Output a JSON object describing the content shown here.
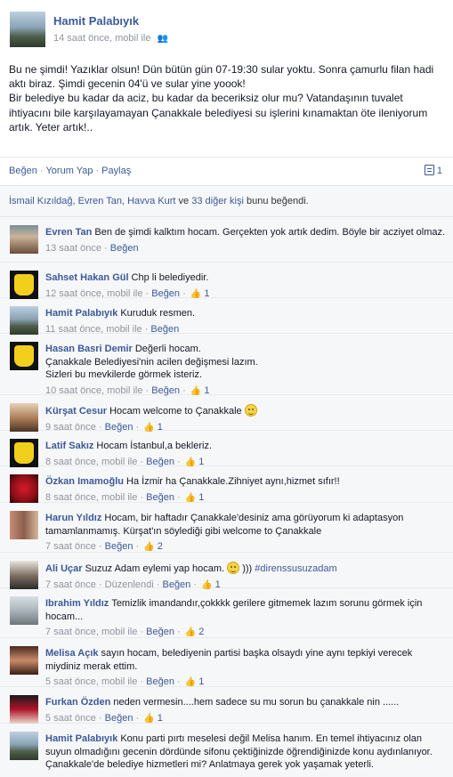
{
  "post": {
    "author": "Hamit Palabıyık",
    "meta": "14 saat önce, mobil ile",
    "body": [
      "Bu ne şimdi! Yazıklar olsun! Dün bütün gün 07-19:30 sular yoktu. Sonra çamurlu filan hadi aktı biraz. Şimdi gecenin 04'ü ve sular yine yoook!",
      "Bir belediye bu kadar da aciz, bu kadar da beceriksiz olur mu? Vatandaşının tuvalet ihtiyacını bile karşılayamayan Çanakkale belediyesi su işlerini kınamaktan öte ileniyorum artık. Yeter artık!.."
    ]
  },
  "actions": {
    "like": "Beğen",
    "comment": "Yorum Yap",
    "share": "Paylaş",
    "sep": "·",
    "comment_count": "1"
  },
  "likes_line": {
    "names": "İsmail Kızıldağ, Evren Tan, Havva Kurt",
    "conj": " ve ",
    "others": "33 diğer kişi",
    "suffix": " bunu beğendi."
  },
  "comments": [
    {
      "name": "Evren Tan",
      "text": "Ben de şimdi kalktım hocam. Gerçekten yok artık dedim. Böyle bir acziyet olmaz.",
      "time": "13 saat önce",
      "like": "Beğen",
      "likes": ""
    },
    {
      "name": "Sahset Hakan Gül",
      "text": "Chp li belediyedir.",
      "time": "12 saat önce, mobil ile",
      "like": "Beğen",
      "likes": "1"
    },
    {
      "name": "Hamit Palabıyık",
      "text": "Kuruduk resmen.",
      "time": "11 saat önce, mobil ile",
      "like": "Beğen",
      "likes": ""
    },
    {
      "name": "Hasan Basri Demir",
      "text": "Değerli hocam.",
      "text2": "Çanakkale Belediyesi'nin acilen değişmesi lazım.",
      "text3": "Sizleri bu mevkilerde görmek isteriz.",
      "time": "10 saat önce, mobil ile",
      "like": "Beğen",
      "likes": "1"
    },
    {
      "name": "Kürşat Cesur",
      "text": "Hocam welcome to Çanakkale",
      "time": "9 saat önce",
      "like": "Beğen",
      "likes": "1"
    },
    {
      "name": "Latif Sakız",
      "text": "Hocam İstanbul,a bekleriz.",
      "time": "8 saat önce, mobil ile",
      "like": "Beğen",
      "likes": "1"
    },
    {
      "name": "Özkan Imamoğlu",
      "text": "Ha İzmir ha Çanakkale.Zihniyet aynı,hizmet sıfır!!",
      "time": "8 saat önce, mobil ile",
      "like": "Beğen",
      "likes": "1"
    },
    {
      "name": "Harun Yıldız",
      "text": "Hocam, bir haftadır Çanakkale'desiniz ama görüyorum ki adaptasyon tamamlanmamış. Kürşat'ın söylediği gibi welcome to Çanakkale",
      "time": "7 saat önce",
      "like": "Beğen",
      "likes": "2"
    },
    {
      "name": "Ali Uçar",
      "text": "Suzuz Adam eylemi yap hocam.",
      "text_after": ")))",
      "hashtag": "#direnssusuzadam",
      "time": "7 saat önce",
      "edited": "Düzenlendi",
      "like": "Beğen",
      "likes": "1"
    },
    {
      "name": "Ibrahim Yıldız",
      "text": "Temizlik imandandır,çokkkk gerilere gitmemek lazım sorunu görmek için hocam...",
      "time": "7 saat önce, mobil ile",
      "like": "Beğen",
      "likes": "2"
    },
    {
      "name": "Melisa Açık",
      "text": "sayın hocam, belediyenin partisi başka olsaydı yine aynı tepkiyi verecek miydiniz merak ettim.",
      "time": "5 saat önce, mobil ile",
      "like": "Beğen",
      "likes": "1"
    },
    {
      "name": "Furkan Özden",
      "text": "neden vermesin....hem sadece su mu sorun bu çanakkale nin ......",
      "time": "5 saat önce",
      "like": "Beğen",
      "likes": "1"
    },
    {
      "name": "Hamit Palabıyık",
      "text": "Konu parti pırtı meselesi değil Melisa hanım. En temel ihtiyacınız olan suyun olmadığını gecenin dördünde sifonu çektiğinizde öğrendiğinizde konu aydınlanıyor. Çanakkale'de belediye hizmetleri mi? Anlatmaya gerek yok yaşamak yeterli.",
      "time": "",
      "like": "",
      "likes": ""
    }
  ],
  "icons": {
    "friends": "friends-audience-icon",
    "comment": "comment-bubble-icon",
    "thumb": "thumbs-up-icon",
    "smiley": "smiley-icon"
  },
  "colors": {
    "link": "#3b5998",
    "meta": "#90949c",
    "bg_comments": "#f6f7f9"
  }
}
